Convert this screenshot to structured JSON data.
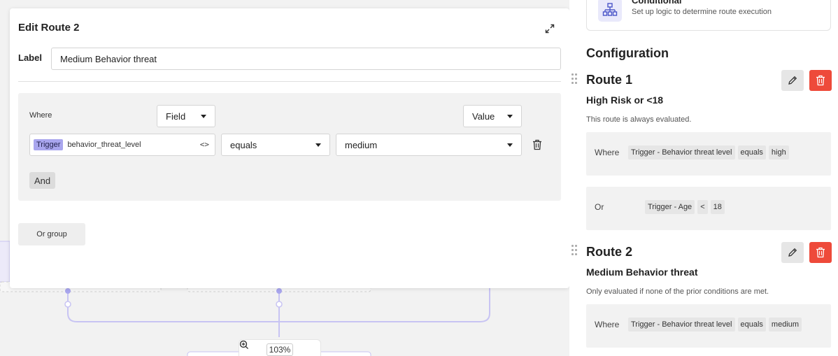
{
  "modal": {
    "title": "Edit Route 2",
    "label_key": "Label",
    "label_value": "Medium Behavior threat",
    "where": "Where",
    "field_header": "Field",
    "value_header": "Value",
    "field_tag": "Trigger",
    "field_name": "behavior_threat_level",
    "code_glyph": "<>",
    "operator": "equals",
    "value": "medium",
    "and_label": "And",
    "or_group_label": "Or group"
  },
  "zoom": {
    "level": "103%"
  },
  "panel": {
    "conditional_card": {
      "title": "Conditional",
      "description": "Set up logic to determine route execution"
    },
    "config_heading": "Configuration",
    "routes": [
      {
        "title": "Route 1",
        "label": "High Risk or <18",
        "note": "This route is always evaluated.",
        "conditions": [
          {
            "keyword": "Where",
            "chips": [
              "Trigger - Behavior threat level",
              "equals",
              "high"
            ]
          },
          {
            "keyword": "Or",
            "chips": [
              "Trigger - Age",
              "<",
              "18"
            ]
          }
        ]
      },
      {
        "title": "Route 2",
        "label": "Medium Behavior threat",
        "note": "Only evaluated if none of the prior conditions are met.",
        "conditions": [
          {
            "keyword": "Where",
            "chips": [
              "Trigger - Behavior threat level",
              "equals",
              "medium"
            ]
          }
        ]
      }
    ]
  },
  "colors": {
    "accent": "#a9a6ee",
    "connector": "#c8c4f3",
    "danger": "#ee4a3a",
    "icon_blue": "#4a55c8"
  }
}
